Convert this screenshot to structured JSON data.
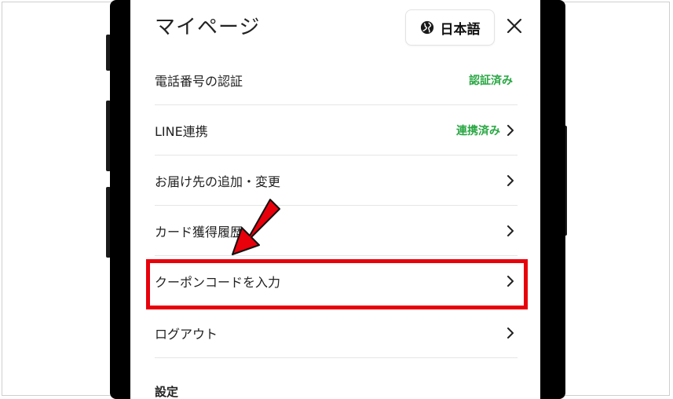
{
  "header": {
    "title": "マイページ",
    "language_label": "日本語"
  },
  "menu": {
    "items": [
      {
        "label": "電話番号の認証",
        "status": "認証済み"
      },
      {
        "label": "LINE連携",
        "status": "連携済み"
      },
      {
        "label": "お届け先の追加・変更",
        "status": ""
      },
      {
        "label": "カード獲得履歴",
        "status": ""
      },
      {
        "label": "クーポンコードを入力",
        "status": ""
      },
      {
        "label": "ログアウト",
        "status": ""
      }
    ]
  },
  "settings": {
    "section_label": "設定"
  },
  "colors": {
    "status_green": "#2aa744",
    "highlight_red": "#e8000b"
  }
}
